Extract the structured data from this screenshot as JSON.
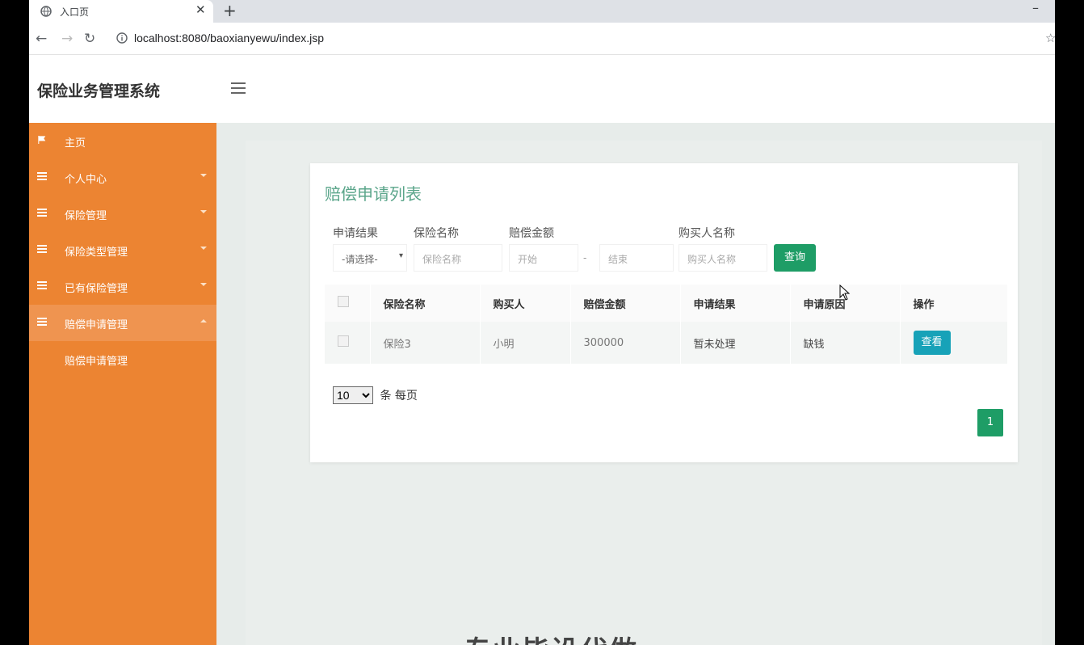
{
  "browser": {
    "tab_title": "入口页",
    "url": "localhost:8080/baoxianyewu/index.jsp"
  },
  "header": {
    "brand": "保险业务管理系统"
  },
  "sidebar": {
    "items": [
      {
        "label": "主页"
      },
      {
        "label": "个人中心"
      },
      {
        "label": "保险管理"
      },
      {
        "label": "保险类型管理"
      },
      {
        "label": "已有保险管理"
      },
      {
        "label": "赔偿申请管理"
      }
    ],
    "sub_item": "赔偿申请管理"
  },
  "card": {
    "title": "赔偿申请列表",
    "filters": {
      "result_label": "申请结果",
      "result_value": "-请选择-",
      "name_label": "保险名称",
      "name_placeholder": "保险名称",
      "amount_label": "赔偿金额",
      "amount_start_placeholder": "开始",
      "amount_dash": "-",
      "amount_end_placeholder": "结束",
      "buyer_label": "购买人名称",
      "buyer_placeholder": "购买人名称",
      "query_button": "查询"
    },
    "table": {
      "headers": [
        "保险名称",
        "购买人",
        "赔偿金额",
        "申请结果",
        "申请原因",
        "操作"
      ],
      "rows": [
        {
          "name": "保险3",
          "buyer": "小明",
          "amount": "300000",
          "result": "暂未处理",
          "reason": "缺钱",
          "action": "查看"
        }
      ]
    },
    "page_size": "10",
    "page_size_suffix": "条 每页",
    "current_page": "1"
  },
  "footer_heading": "专业毕设代做"
}
